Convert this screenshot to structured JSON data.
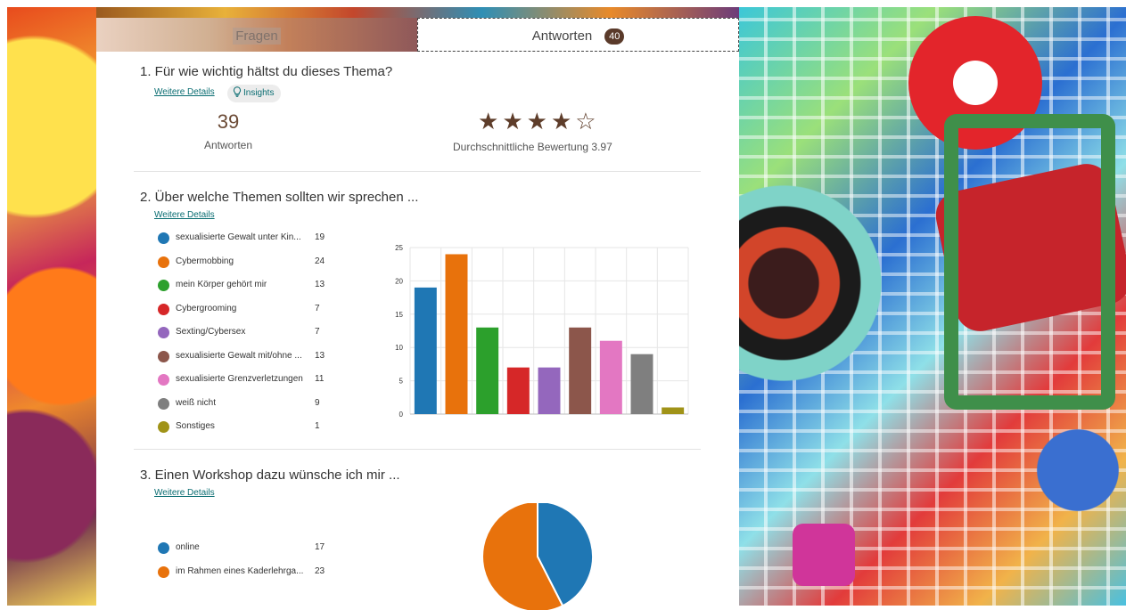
{
  "tabs": {
    "questions_label": "Fragen",
    "answers_label": "Antworten",
    "answers_count": "40"
  },
  "q1": {
    "title": "1.  Für wie wichtig hältst du dieses Thema?",
    "details_link": "Weitere Details",
    "insights_label": "Insights",
    "response_count": "39",
    "response_label": "Antworten",
    "stars_filled": 4,
    "stars_total": 5,
    "average_label": "Durchschnittliche Bewertung 3.97"
  },
  "q2": {
    "title": "2.  Über welche Themen sollten wir sprechen ...",
    "details_link": "Weitere Details",
    "legend": [
      {
        "label": "sexualisierte Gewalt unter Kin...",
        "value": "19",
        "color": "#1f77b4"
      },
      {
        "label": "Cybermobbing",
        "value": "24",
        "color": "#e8720c"
      },
      {
        "label": "mein Körper gehört mir",
        "value": "13",
        "color": "#2ca02c"
      },
      {
        "label": "Cybergrooming",
        "value": "7",
        "color": "#d62728"
      },
      {
        "label": "Sexting/Cybersex",
        "value": "7",
        "color": "#9467bd"
      },
      {
        "label": "sexualisierte Gewalt mit/ohne ...",
        "value": "13",
        "color": "#8c564b"
      },
      {
        "label": "sexualisierte Grenzverletzungen",
        "value": "11",
        "color": "#e377c2"
      },
      {
        "label": "weiß nicht",
        "value": "9",
        "color": "#7f7f7f"
      },
      {
        "label": "Sonstiges",
        "value": "1",
        "color": "#a09318"
      }
    ]
  },
  "q3": {
    "title": "3.  Einen Workshop dazu wünsche ich mir ...",
    "details_link": "Weitere Details",
    "legend": [
      {
        "label": "online",
        "value": "17",
        "color": "#1f77b4"
      },
      {
        "label": "im Rahmen eines Kaderlehrga...",
        "value": "23",
        "color": "#e8720c"
      }
    ]
  },
  "chart_data": [
    {
      "type": "bar",
      "categories": [
        "sexualisierte Gewalt unter Kin...",
        "Cybermobbing",
        "mein Körper gehört mir",
        "Cybergrooming",
        "Sexting/Cybersex",
        "sexualisierte Gewalt mit/ohne ...",
        "sexualisierte Grenzverletzungen",
        "weiß nicht",
        "Sonstiges"
      ],
      "values": [
        19,
        24,
        13,
        7,
        7,
        13,
        11,
        9,
        1
      ],
      "colors": [
        "#1f77b4",
        "#e8720c",
        "#2ca02c",
        "#d62728",
        "#9467bd",
        "#8c564b",
        "#e377c2",
        "#7f7f7f",
        "#a09318"
      ],
      "yticks": [
        0,
        5,
        10,
        15,
        20,
        25
      ],
      "ylim": [
        0,
        25
      ],
      "grid": true
    },
    {
      "type": "pie",
      "categories": [
        "online",
        "im Rahmen eines Kaderlehrga..."
      ],
      "values": [
        17,
        23
      ],
      "colors": [
        "#1f77b4",
        "#e8720c"
      ]
    }
  ]
}
